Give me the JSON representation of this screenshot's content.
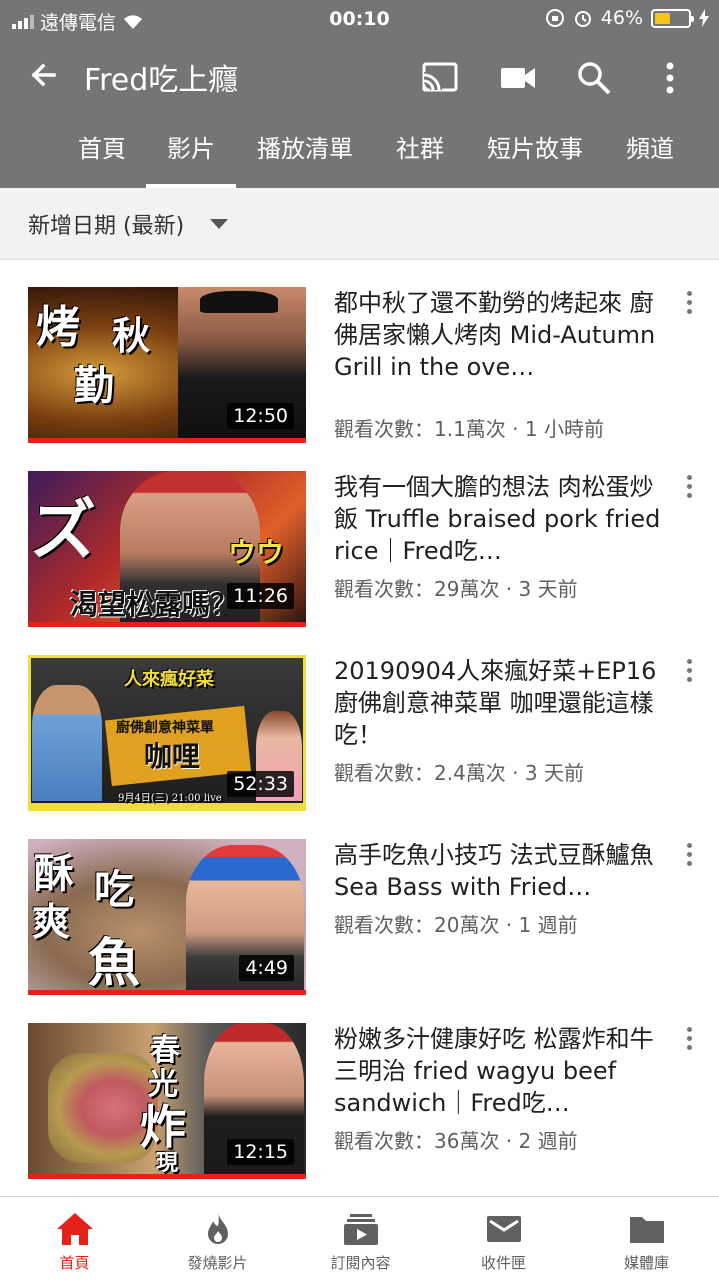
{
  "status_bar": {
    "carrier": "遠傳電信",
    "time": "00:10",
    "battery": "46%",
    "battery_level": 0.46
  },
  "header": {
    "channel_name": "Fred吃上癮",
    "icons": [
      "back-arrow-icon",
      "cast-icon",
      "video-camera-icon",
      "search-icon",
      "more-vert-icon"
    ],
    "background_color": "#757575"
  },
  "tabs": [
    {
      "label": "首頁",
      "active": false
    },
    {
      "label": "影片",
      "active": true
    },
    {
      "label": "播放清單",
      "active": false
    },
    {
      "label": "社群",
      "active": false
    },
    {
      "label": "短片故事",
      "active": false
    },
    {
      "label": "頻道",
      "active": false
    }
  ],
  "sort": {
    "label": "新增日期 (最新)"
  },
  "videos": [
    {
      "title": "都中秋了還不勤勞的烤起來 廚佛居家懶人烤肉 Mid-Autumn Grill   in the ove…",
      "meta": "觀看次數：1.1萬次 · 1 小時前",
      "duration": "12:50",
      "thumb_text": [
        "烤",
        "秋",
        "勤"
      ]
    },
    {
      "title": "我有一個大膽的想法 肉松蛋炒飯 Truffle braised pork fried rice｜Fred吃…",
      "meta": "觀看次數：29萬次 · 3 天前",
      "duration": "11:26",
      "thumb_text": [
        "ズ",
        "ウウ",
        "渴望松露嗎？"
      ]
    },
    {
      "title": "20190904人來瘋好菜+EP16 廚佛創意神菜單 咖哩還能這樣吃！",
      "meta": "觀看次數：2.4萬次 · 3 天前",
      "duration": "52:33",
      "thumb_text": [
        "人來瘋好菜",
        "廚佛創意神菜單",
        "咖哩",
        "9月4日(三) 21:00 live"
      ]
    },
    {
      "title": "高手吃魚小技巧 法式豆酥鱸魚Sea Bass with Fried…",
      "meta": "觀看次數：20萬次 · 1 週前",
      "duration": "4:49",
      "thumb_text": [
        "酥",
        "爽",
        "吃",
        "魚"
      ]
    },
    {
      "title": "粉嫩多汁健康好吃 松露炸和牛三明治 fried wagyu beef sandwich｜Fred吃…",
      "meta": "觀看次數：36萬次 · 2 週前",
      "duration": "12:15",
      "thumb_text": [
        "春",
        "光",
        "炸",
        "現"
      ]
    }
  ],
  "bottom_nav": [
    {
      "label": "首頁",
      "icon": "home-icon",
      "active": true
    },
    {
      "label": "發燒影片",
      "icon": "flame-icon",
      "active": false
    },
    {
      "label": "訂閱內容",
      "icon": "subscriptions-icon",
      "active": false
    },
    {
      "label": "收件匣",
      "icon": "mail-icon",
      "active": false
    },
    {
      "label": "媒體庫",
      "icon": "folder-icon",
      "active": false
    }
  ],
  "colors": {
    "accent": "#e62117",
    "header": "#757575"
  }
}
